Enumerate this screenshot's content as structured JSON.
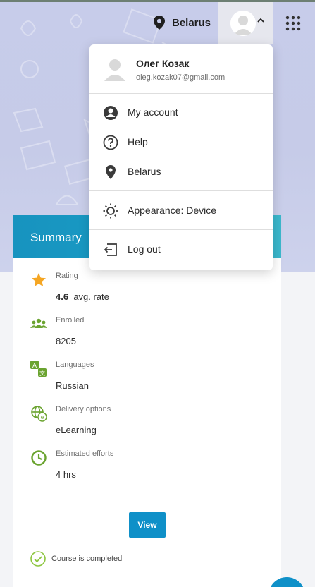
{
  "header": {
    "location": "Belarus"
  },
  "user_menu": {
    "name": "Олег Козак",
    "email": "oleg.kozak07@gmail.com",
    "items": [
      {
        "label": "My account",
        "icon": "account-circle-icon"
      },
      {
        "label": "Help",
        "icon": "help-circle-icon"
      },
      {
        "label": "Belarus",
        "icon": "location-pin-icon"
      },
      {
        "label": "Appearance: Device",
        "icon": "brightness-icon"
      },
      {
        "label": "Log out",
        "icon": "logout-icon"
      }
    ]
  },
  "summary": {
    "title": "Summary",
    "rating": {
      "label": "Rating",
      "value": "4.6",
      "suffix": "avg. rate"
    },
    "enrolled": {
      "label": "Enrolled",
      "value": "8205"
    },
    "languages": {
      "label": "Languages",
      "value": "Russian"
    },
    "delivery": {
      "label": "Delivery options",
      "value": "eLearning"
    },
    "efforts": {
      "label": "Estimated efforts",
      "value": "4 hrs"
    },
    "view_label": "View",
    "completed_label": "Course is completed"
  },
  "colors": {
    "accent": "#0f90c8",
    "green": "#6aa32f",
    "star": "#f5a623"
  }
}
